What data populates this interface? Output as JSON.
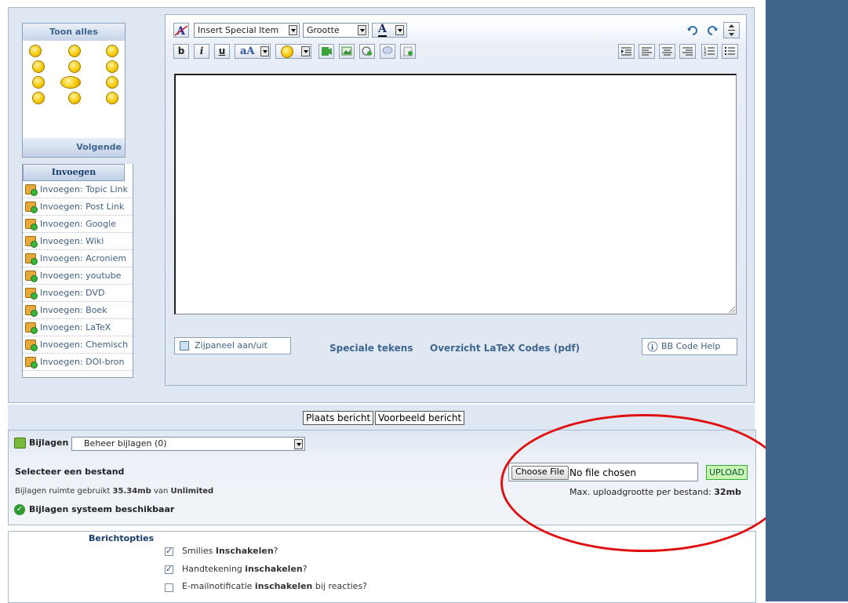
{
  "smilies": {
    "show_all": "Toon alles",
    "next": "Volgende"
  },
  "insert": {
    "header": "Invoegen",
    "items": [
      "Invoegen: Topic Link",
      "Invoegen: Post Link",
      "Invoegen: Google",
      "Invoegen: Wiki",
      "Invoegen: Acroniem",
      "Invoegen: youtube",
      "Invoegen: DVD",
      "Invoegen: Boek",
      "Invoegen: LaTeX",
      "Invoegen: Chemisch",
      "Invoegen: DOI-bron"
    ]
  },
  "toolbar": {
    "special_item": "Insert Special Item",
    "size": "Grootte",
    "font_color_glyph": "A",
    "bold": "b",
    "italic": "i",
    "underline": "u",
    "font_glyph": "aA"
  },
  "editor": {
    "side_panel_toggle": "Zijpaneel aan/uit",
    "special_chars": "Speciale tekens",
    "latex_overview": "Overzicht LaTeX Codes (pdf)",
    "bbcode_help": "BB Code Help"
  },
  "actions": {
    "post": "Plaats bericht",
    "preview": "Voorbeeld bericht"
  },
  "attachments": {
    "label": "Bijlagen",
    "manage_select": "Beheer bijlagen (0)",
    "select_file": "Selecteer een bestand",
    "space_prefix": "Bijlagen ruimte gebruikt",
    "space_used": "35.34mb",
    "space_mid": "van",
    "space_limit": "Unlimited",
    "system_status": "Bijlagen systeem beschikbaar",
    "choose_file": "Choose File",
    "no_file": "No file chosen",
    "upload": "UPLOAD",
    "max_label": "Max. uploadgrootte per bestand:",
    "max_value": "32mb"
  },
  "options": {
    "header": "Berichtopties",
    "items": [
      {
        "pre": "Smilies",
        "strong": "Inschakelen",
        "post": "?",
        "checked": true
      },
      {
        "pre": "Handtekening",
        "strong": "inschakelen",
        "post": "?",
        "checked": true
      },
      {
        "pre": "E-mailnotificatie",
        "strong": "inschakelen",
        "post": " bij reacties?",
        "checked": false
      }
    ]
  },
  "colors": {
    "right_band": "#41668b",
    "link": "#3f6691",
    "annotation_ellipse": "#e01010"
  }
}
